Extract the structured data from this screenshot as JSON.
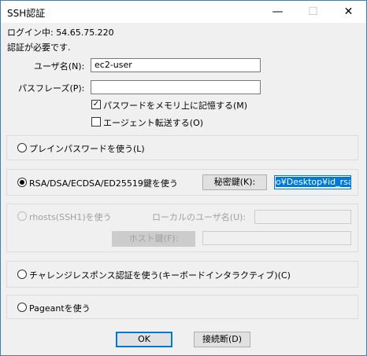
{
  "window": {
    "title": "SSH認証",
    "minimize_glyph": "—",
    "maximize_glyph": "☐",
    "close_glyph": "✕"
  },
  "login": {
    "text": "ログイン中: 54.65.75.220"
  },
  "auth_required": {
    "text": "認証が必要です."
  },
  "username": {
    "label": "ユーザ名(N):",
    "value": "ec2-user"
  },
  "passphrase": {
    "label": "パスフレーズ(P):",
    "value": ""
  },
  "options": {
    "remember_password": {
      "label": "パスワードをメモリ上に記憶する(M)",
      "checked": true
    },
    "agent_forwarding": {
      "label": "エージェント転送する(O)",
      "checked": false
    }
  },
  "methods": {
    "plain_password": {
      "label": "プレインパスワードを使う(L)",
      "selected": false
    },
    "rsa": {
      "label": "RSA/DSA/ECDSA/ED25519鍵を使う",
      "selected": true,
      "private_key_button": "秘密鍵(K):",
      "key_path": "o¥Desktop¥id_rsa"
    },
    "rhosts": {
      "label": "rhosts(SSH1)を使う",
      "selected": false,
      "local_user_label": "ローカルのユーザ名(U):",
      "host_key_button": "ホスト鍵(F):"
    },
    "challenge": {
      "label": "チャレンジレスポンス認証を使う(キーボードインタラクティブ)(C)",
      "selected": false
    },
    "pageant": {
      "label": "Pageantを使う",
      "selected": false
    }
  },
  "buttons": {
    "ok": "OK",
    "disconnect": "接続断(D)"
  },
  "checkmark": "✓"
}
